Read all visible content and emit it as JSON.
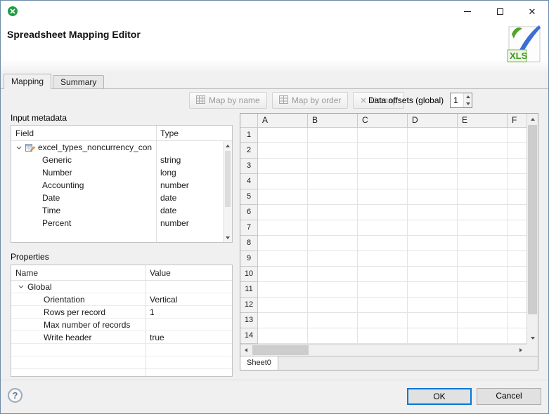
{
  "window": {
    "close_glyph": "✕"
  },
  "header": {
    "title": "Spreadsheet Mapping Editor"
  },
  "tabs": {
    "mapping": "Mapping",
    "summary": "Summary"
  },
  "toolbar": {
    "map_by_name": "Map by name",
    "map_by_order": "Map by order",
    "unmap": "Unmap",
    "unmap_glyph": "✕",
    "data_offsets_label": "Data offsets (global)",
    "data_offsets_value": "1"
  },
  "input_metadata": {
    "label": "Input metadata",
    "columns": {
      "field": "Field",
      "type": "Type"
    },
    "root": "excel_types_noncurrency_con",
    "rows": [
      {
        "field": "Generic",
        "type": "string"
      },
      {
        "field": "Number",
        "type": "long"
      },
      {
        "field": "Accounting",
        "type": "number"
      },
      {
        "field": "Date",
        "type": "date"
      },
      {
        "field": "Time",
        "type": "date"
      },
      {
        "field": "Percent",
        "type": "number"
      }
    ]
  },
  "properties": {
    "label": "Properties",
    "columns": {
      "name": "Name",
      "value": "Value"
    },
    "root": "Global",
    "rows": [
      {
        "name": "Orientation",
        "value": "Vertical"
      },
      {
        "name": "Rows per record",
        "value": "1"
      },
      {
        "name": "Max number of records",
        "value": ""
      },
      {
        "name": "Write header",
        "value": "true"
      }
    ]
  },
  "spreadsheet": {
    "columns": [
      "A",
      "B",
      "C",
      "D",
      "E",
      "F"
    ],
    "rows": [
      "1",
      "2",
      "3",
      "4",
      "5",
      "6",
      "7",
      "8",
      "9",
      "10",
      "11",
      "12",
      "13",
      "14"
    ],
    "sheet_tab": "Sheet0"
  },
  "footer": {
    "ok": "OK",
    "cancel": "Cancel",
    "help_glyph": "?"
  }
}
